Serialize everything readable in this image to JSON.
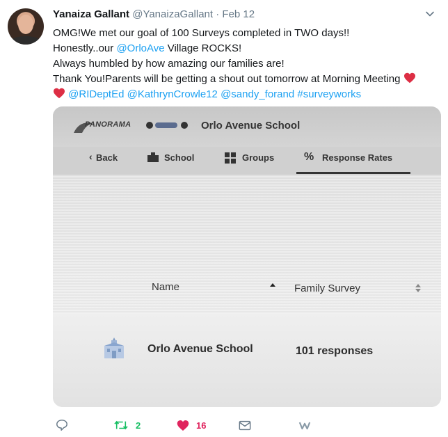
{
  "tweet": {
    "author_name": "Yanaiza Gallant",
    "author_handle": "@YanaizaGallant",
    "separator": "·",
    "date": "Feb 12",
    "line1": "OMG!We met our goal of 100 Surveys completed in TWO days!!",
    "line2_pre": "Honestly..our ",
    "line2_mention": "@OrloAve",
    "line2_post": " Village ROCKS!",
    "line3": "Always humbled by how amazing our families are!",
    "line4": "Thank You!Parents will be getting a shout out tomorrow at Morning Meeting",
    "mention1": "@RIDeptEd",
    "mention2": "@KathrynCrowle12",
    "mention3": "@sandy_forand",
    "hashtag": "#surveyworks"
  },
  "photo": {
    "logo": "PANORAMA",
    "school_title": "Orlo Avenue School",
    "nav": {
      "back": "Back",
      "school": "School",
      "groups": "Groups",
      "response_rates": "Response Rates"
    },
    "table": {
      "col_name": "Name",
      "col_family": "Family Survey",
      "row_name": "Orlo Avenue School",
      "row_value": "101 responses"
    }
  },
  "actions": {
    "retweets": "2",
    "likes": "16",
    "reply_icon": "reply-icon",
    "retweet_icon": "retweet-icon",
    "like_icon": "heart-icon",
    "dm_icon": "envelope-icon",
    "extra_icon": "w-icon",
    "retweet_color": "#17bf63",
    "like_color": "#e0245e"
  },
  "colors": {
    "link": "#1da1f2",
    "muted": "#657786",
    "heart_emoji": "#dd2e44"
  }
}
